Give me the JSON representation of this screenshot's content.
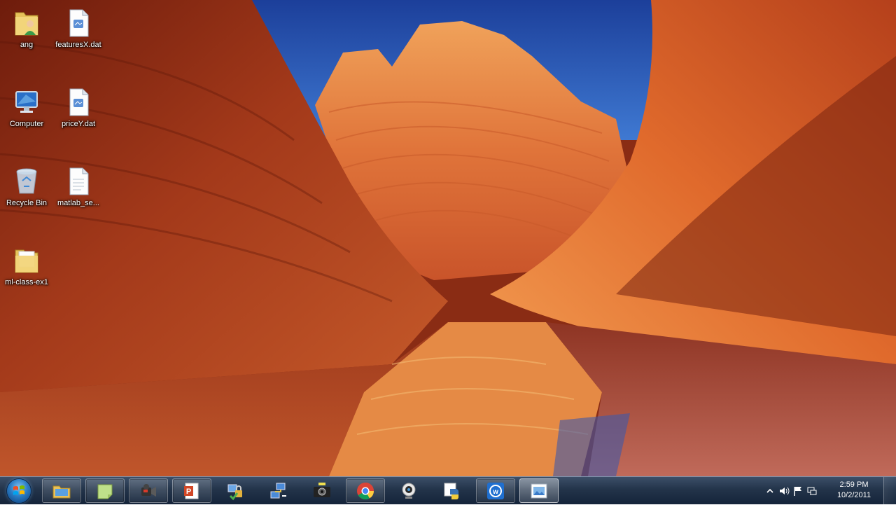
{
  "desktop": {
    "icons": [
      {
        "label": "ang",
        "icon": "user-folder-icon"
      },
      {
        "label": "featuresX.dat",
        "icon": "file-icon"
      },
      {
        "label": "Computer",
        "icon": "computer-icon"
      },
      {
        "label": "priceY.dat",
        "icon": "file-icon"
      },
      {
        "label": "Recycle Bin",
        "icon": "recycle-bin-icon"
      },
      {
        "label": "matlab_se...",
        "icon": "document-icon"
      },
      {
        "label": "ml-class-ex1",
        "icon": "folder-icon"
      }
    ]
  },
  "taskbar": {
    "start_icon": "windows-logo-icon",
    "items": [
      {
        "icon": "file-explorer-icon"
      },
      {
        "icon": "sticky-notes-icon"
      },
      {
        "icon": "video-camera-icon"
      },
      {
        "icon": "powerpoint-icon"
      },
      {
        "icon": "network-lock-icon"
      },
      {
        "icon": "network-connection-icon"
      },
      {
        "icon": "camera-icon"
      },
      {
        "icon": "chrome-icon"
      },
      {
        "icon": "webcam-icon"
      },
      {
        "icon": "python-icon"
      },
      {
        "icon": "blue-w-app-icon"
      },
      {
        "icon": "image-viewer-icon"
      }
    ],
    "tray": {
      "icons": [
        "show-hidden-icons-chevron-icon",
        "volume-icon",
        "action-center-flag-icon",
        "network-icon"
      ],
      "time": "2:59 PM",
      "date": "10/2/2011"
    }
  }
}
